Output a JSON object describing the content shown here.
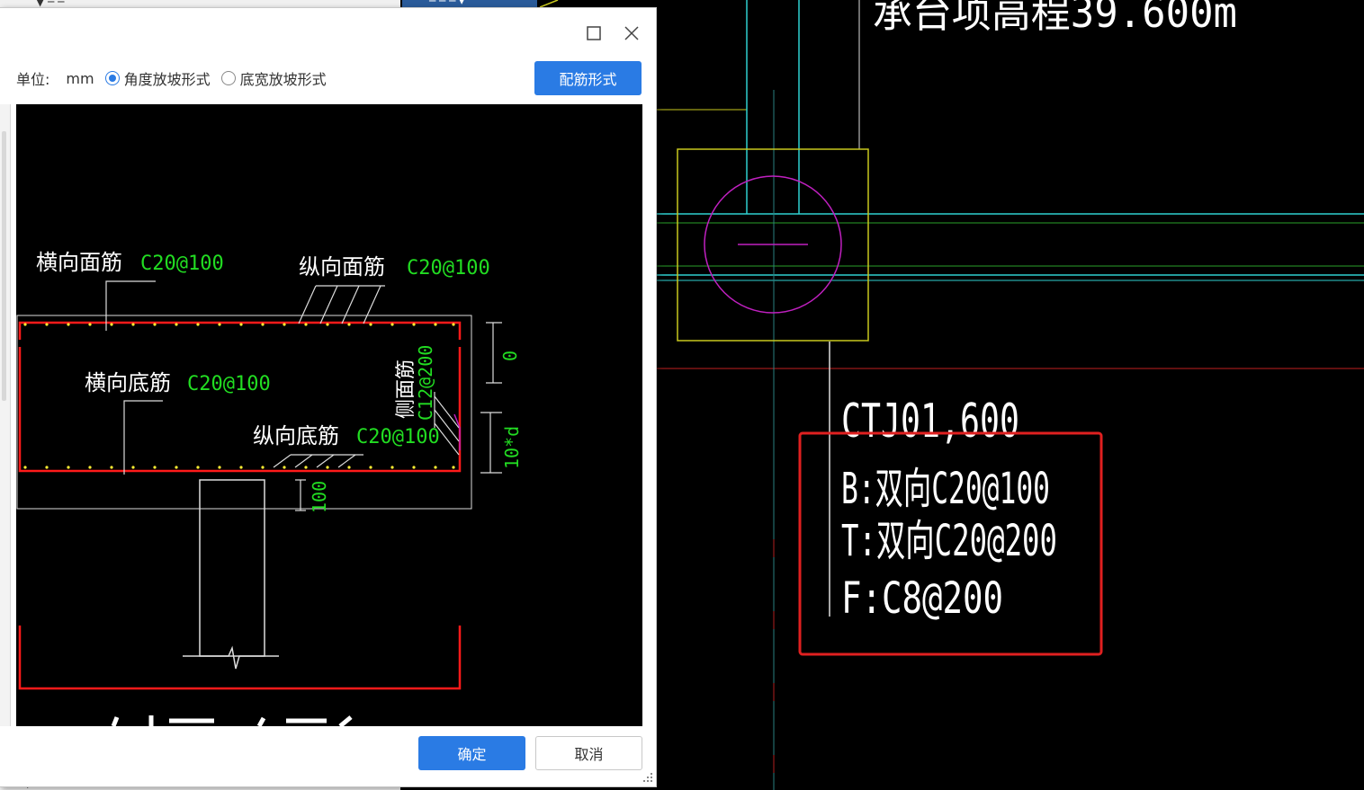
{
  "window": {
    "maximize_icon": "maximize-icon",
    "close_icon": "close-icon"
  },
  "toolbar": {
    "unit_label": "单位:",
    "unit_value": "mm",
    "radio_angle_label": "角度放坡形式",
    "radio_bottom_label": "底宽放坡形式",
    "selected_radio": "angle",
    "rebar_form_button": "配筋形式"
  },
  "preview": {
    "top_transverse_label": "横向面筋",
    "top_transverse_value": "C20@100",
    "top_longitudinal_label": "纵向面筋",
    "top_longitudinal_value": "C20@100",
    "bottom_transverse_label": "横向底筋",
    "bottom_transverse_value": "C20@100",
    "bottom_longitudinal_label": "纵向底筋",
    "bottom_longitudinal_value": "C20@100",
    "side_label": "侧面筋",
    "side_value": "C12@200",
    "dim_top": "0",
    "dim_anchor": "10*d",
    "dim_cover": "100"
  },
  "footer": {
    "ok_button": "确定",
    "cancel_button": "取消"
  },
  "cad": {
    "top_text": "承台项高程39.600m",
    "title": "CTJ01,600",
    "line_b": "B:双向C20@100",
    "line_t": "T:双向C20@200",
    "line_f": "F:C8@200"
  },
  "colors": {
    "accent": "#2a7be4",
    "rebar_red": "#ff1a1a",
    "label_green": "#22dd22",
    "cad_yellow": "#c8c81e",
    "cad_cyan": "#2fd0d0",
    "cad_magenta": "#c020c0",
    "highlight_red": "#e02020"
  }
}
